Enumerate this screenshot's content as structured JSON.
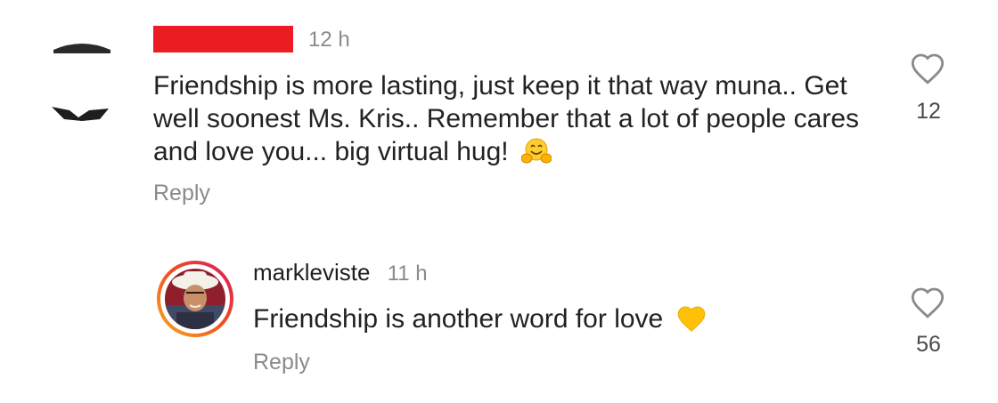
{
  "comments": [
    {
      "username_redacted": true,
      "time": "12 h",
      "text": "Friendship is more lasting, just keep it that way muna.. Get well soonest Ms. Kris.. Remember that a lot of people cares and love you... big virtual hug!",
      "emoji": "hugging-face",
      "reply_label": "Reply",
      "like_count": "12"
    },
    {
      "username": "markleviste",
      "time": "11 h",
      "text": "Friendship is another word for love",
      "emoji": "yellow-heart",
      "reply_label": "Reply",
      "like_count": "56"
    }
  ],
  "colors": {
    "redaction": "#ec1c24",
    "meta_text": "#8a8a8a",
    "story_ring_start": "#f9a825",
    "story_ring_end": "#d81b60"
  }
}
